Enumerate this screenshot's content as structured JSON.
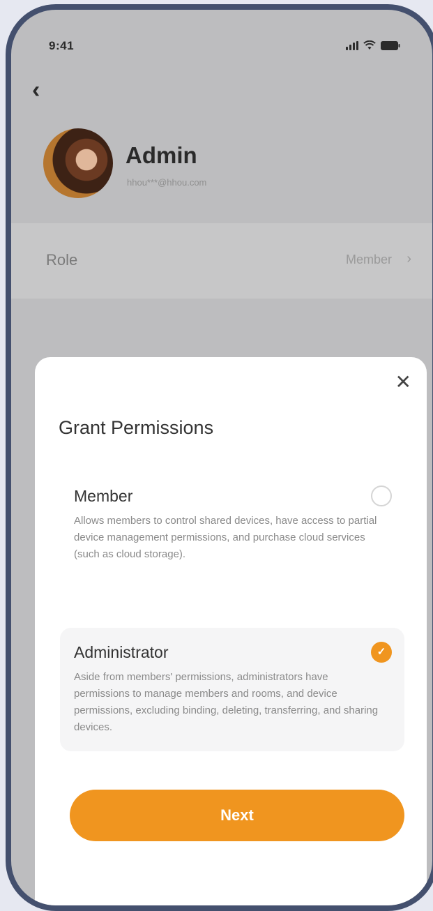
{
  "status_bar": {
    "time": "9:41"
  },
  "icons": {
    "back": "back-chevron",
    "close": "close-x",
    "radio_checked": "check",
    "signal": "cellular-signal",
    "wifi": "wifi",
    "battery": "battery"
  },
  "profile": {
    "name": "Admin",
    "email": "hhou***@hhou.com"
  },
  "role_row": {
    "label": "Role",
    "value": "Member"
  },
  "sheet": {
    "title": "Grant Permissions",
    "options": [
      {
        "title": "Member",
        "description": "Allows members to control shared devices, have access to partial device management permissions, and purchase cloud services (such as cloud storage).",
        "selected": false
      },
      {
        "title": "Administrator",
        "description": "Aside from members' permissions, administrators have permissions to manage members and rooms, and device permissions, excluding binding, deleting, transferring, and sharing devices.",
        "selected": true
      }
    ],
    "next_label": "Next"
  },
  "colors": {
    "accent": "#f0951f",
    "overlay": "#bdbdbf",
    "device_frame": "#44506e"
  }
}
